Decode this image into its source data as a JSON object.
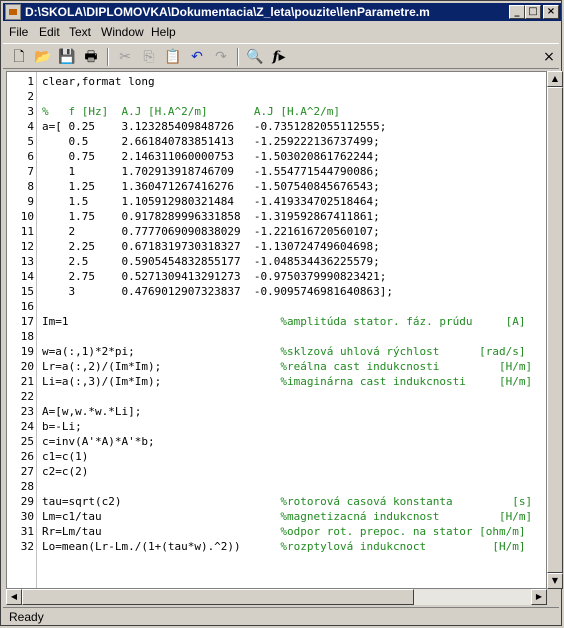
{
  "window": {
    "title": "D:\\SKOLA\\DIPLOMOVKA\\Dokumentacia\\Z_leta\\pouzite\\lenParametre.m"
  },
  "title_buttons": {
    "minimize": "_",
    "maximize": "□",
    "close": "×"
  },
  "menu": [
    "File",
    "Edit",
    "Text",
    "Window",
    "Help"
  ],
  "toolbar": {
    "icons": [
      "new-file-icon",
      "open-folder-icon",
      "save-icon",
      "print-icon",
      "cut-icon",
      "copy-icon",
      "paste-icon",
      "undo-icon",
      "redo-icon",
      "find-icon",
      "function-icon"
    ],
    "close_label": "×"
  },
  "lines": [
    {
      "n": "1",
      "code": "clear,format long",
      "comment": ""
    },
    {
      "n": "2",
      "code": "",
      "comment": ""
    },
    {
      "n": "3",
      "code": "",
      "comment": "%   f [Hz]  A.J [H.A^2/m]       A.J [H.A^2/m]"
    },
    {
      "n": "4",
      "code": "a=[ 0.25    3.123285409848726   -0.7351282055112555;",
      "comment": ""
    },
    {
      "n": "5",
      "code": "    0.5     2.661840783851413   -1.259222136737499;",
      "comment": ""
    },
    {
      "n": "6",
      "code": "    0.75    2.146311060000753   -1.503020861762244;",
      "comment": ""
    },
    {
      "n": "7",
      "code": "    1       1.702913918746709   -1.554771544790086;",
      "comment": ""
    },
    {
      "n": "8",
      "code": "    1.25    1.360471267416276   -1.507540845676543;",
      "comment": ""
    },
    {
      "n": "9",
      "code": "    1.5     1.105912980321484   -1.419334702518464;",
      "comment": ""
    },
    {
      "n": "10",
      "code": "    1.75    0.9178289996331858  -1.319592867411861;",
      "comment": ""
    },
    {
      "n": "11",
      "code": "    2       0.7777069090838029  -1.221616720560107;",
      "comment": ""
    },
    {
      "n": "12",
      "code": "    2.25    0.6718319730318327  -1.130724749604698;",
      "comment": ""
    },
    {
      "n": "13",
      "code": "    2.5     0.5905454832855177  -1.048534436225579;",
      "comment": ""
    },
    {
      "n": "14",
      "code": "    2.75    0.5271309413291273  -0.9750379990823421;",
      "comment": ""
    },
    {
      "n": "15",
      "code": "    3       0.4769012907323837  -0.9095746981640863];",
      "comment": ""
    },
    {
      "n": "16",
      "code": "",
      "comment": ""
    },
    {
      "n": "17",
      "code": "Im=1                                ",
      "comment": "%amplitúda stator. fáz. prúdu     [A]"
    },
    {
      "n": "18",
      "code": "",
      "comment": ""
    },
    {
      "n": "19",
      "code": "w=a(:,1)*2*pi;                      ",
      "comment": "%sklzová uhlová rýchlost      [rad/s]"
    },
    {
      "n": "20",
      "code": "Lr=a(:,2)/(Im*Im);                  ",
      "comment": "%reálna cast indukcnosti         [H/m]"
    },
    {
      "n": "21",
      "code": "Li=a(:,3)/(Im*Im);                  ",
      "comment": "%imaginárna cast indukcnosti     [H/m]"
    },
    {
      "n": "22",
      "code": "",
      "comment": ""
    },
    {
      "n": "23",
      "code": "A=[w,w.*w.*Li];",
      "comment": ""
    },
    {
      "n": "24",
      "code": "b=-Li;",
      "comment": ""
    },
    {
      "n": "25",
      "code": "c=inv(A'*A)*A'*b;",
      "comment": ""
    },
    {
      "n": "26",
      "code": "c1=c(1)",
      "comment": ""
    },
    {
      "n": "27",
      "code": "c2=c(2)",
      "comment": ""
    },
    {
      "n": "28",
      "code": "",
      "comment": ""
    },
    {
      "n": "29",
      "code": "tau=sqrt(c2)                        ",
      "comment": "%rotorová casová konstanta         [s]"
    },
    {
      "n": "30",
      "code": "Lm=c1/tau                           ",
      "comment": "%magnetizacná indukcnost         [H/m]"
    },
    {
      "n": "31",
      "code": "Rr=Lm/tau                           ",
      "comment": "%odpor rot. prepoc. na stator [ohm/m]"
    },
    {
      "n": "32",
      "code": "Lo=mean(Lr-Lm./(1+(tau*w).^2))      ",
      "comment": "%rozptylová indukcnoct          [H/m]"
    }
  ],
  "status": "Ready",
  "colors": {
    "titlebar": "#0a246a",
    "comment": "#228b22"
  }
}
